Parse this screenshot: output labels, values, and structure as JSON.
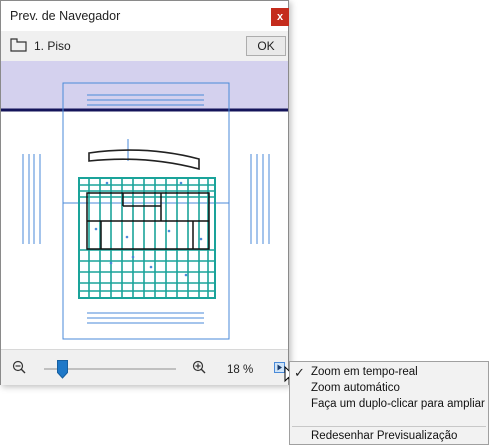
{
  "window": {
    "title": "Prev. de Navegador",
    "close_label": "x"
  },
  "toolbar": {
    "floor_label": "1. Piso",
    "ok_label": "OK"
  },
  "statusbar": {
    "zoom_percent": "18 %",
    "slider_level": 0.15
  },
  "menu": {
    "items": [
      {
        "label": "Zoom em tempo-real",
        "checked": true
      },
      {
        "label": "Zoom automático",
        "checked": false
      },
      {
        "label": "Faça um duplo-clicar para ampliar",
        "checked": false
      },
      {
        "label": "Redesenhar Previsualização",
        "checked": false
      }
    ]
  },
  "colors": {
    "accent": "#1e78c8",
    "plan_cyan": "#1aa39a",
    "guide_blue": "#4a8ad8",
    "band": "#d4d1ee",
    "close_red": "#c42b1c"
  }
}
